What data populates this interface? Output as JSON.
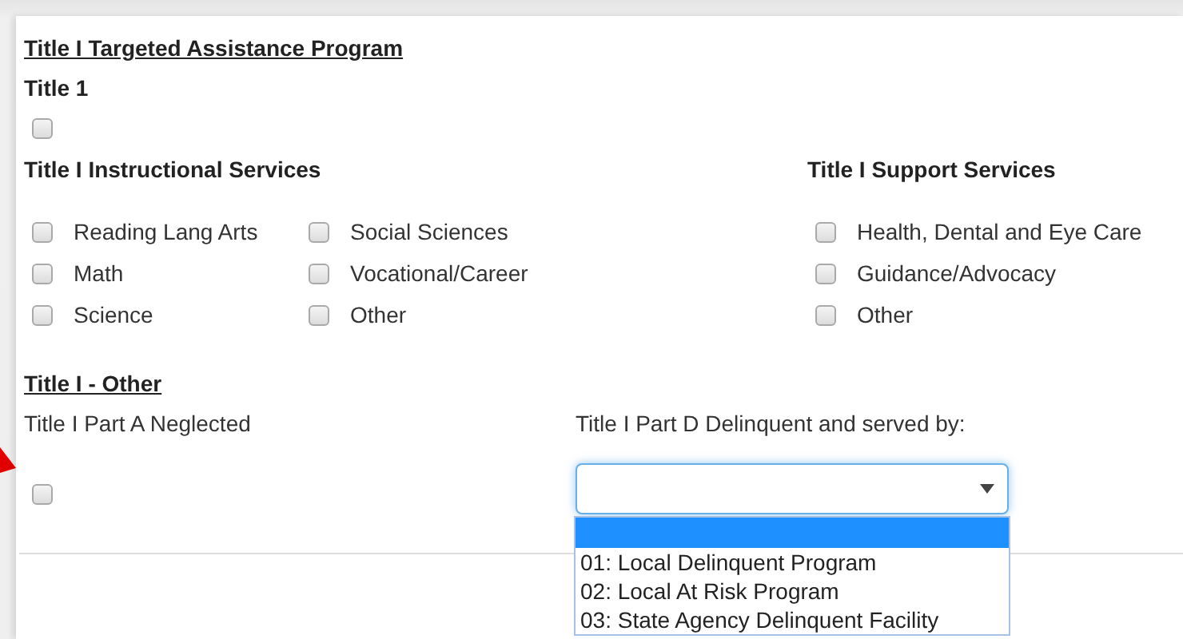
{
  "program": {
    "heading": "Title I Targeted Assistance Program",
    "title1": {
      "label": "Title 1",
      "checked": false
    },
    "instructional": {
      "heading": "Title I Instructional Services",
      "options": [
        {
          "label": "Reading Lang Arts",
          "checked": false
        },
        {
          "label": "Math",
          "checked": false
        },
        {
          "label": "Science",
          "checked": false
        },
        {
          "label": "Social Sciences",
          "checked": false
        },
        {
          "label": "Vocational/Career",
          "checked": false
        },
        {
          "label": "Other",
          "checked": false
        }
      ]
    },
    "support": {
      "heading": "Title I Support Services",
      "options": [
        {
          "label": "Health, Dental and Eye Care",
          "checked": false
        },
        {
          "label": "Guidance/Advocacy",
          "checked": false
        },
        {
          "label": "Other",
          "checked": false
        }
      ]
    }
  },
  "other": {
    "heading": "Title I - Other",
    "part_a": {
      "label": "Title I Part A Neglected",
      "checked": false
    },
    "part_d": {
      "label": "Title I Part D Delinquent and served by:",
      "expanded": true,
      "blank_selected": true,
      "options": [
        {
          "label": "01: Local Delinquent Program",
          "selected": false
        },
        {
          "label": "02: Local At Risk Program",
          "selected": false
        },
        {
          "label": "03: State Agency Delinquent Facility",
          "selected": false
        }
      ]
    }
  }
}
